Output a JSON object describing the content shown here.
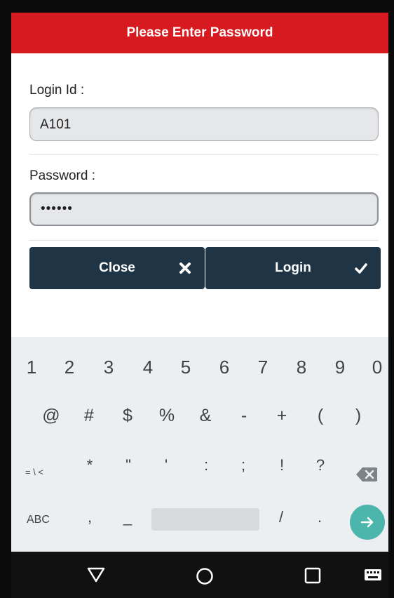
{
  "header": {
    "title": "Please Enter Password"
  },
  "form": {
    "login_label": "Login Id :",
    "login_value": "A101",
    "password_label": "Password :",
    "password_value": "••••••"
  },
  "buttons": {
    "close_label": "Close",
    "login_label": "Login"
  },
  "keyboard": {
    "numbers": [
      "1",
      "2",
      "3",
      "4",
      "5",
      "6",
      "7",
      "8",
      "9",
      "0"
    ],
    "symbols": [
      "@",
      "#",
      "$",
      "%",
      "&",
      "-",
      "+",
      "(",
      ")"
    ],
    "symbols2": [
      "*",
      "\"",
      "'",
      ":",
      ";",
      "!",
      "?"
    ],
    "more_symbols_label": "= \\ <",
    "abc_label": "ABC",
    "comma": ",",
    "underscore": "_",
    "slash": "/",
    "period": "."
  },
  "colors": {
    "header": "#d71a1f",
    "buttons": "#1f3444",
    "keyboard_bg": "#eceff1",
    "enter_key": "#4db6ac"
  },
  "icons": {
    "close": "x-icon",
    "login": "check-icon",
    "backspace": "backspace-icon",
    "enter": "arrow-right-icon",
    "back": "triangle-back-icon",
    "home": "circle-home-icon",
    "recents": "square-recents-icon",
    "keyboard": "keyboard-icon"
  }
}
